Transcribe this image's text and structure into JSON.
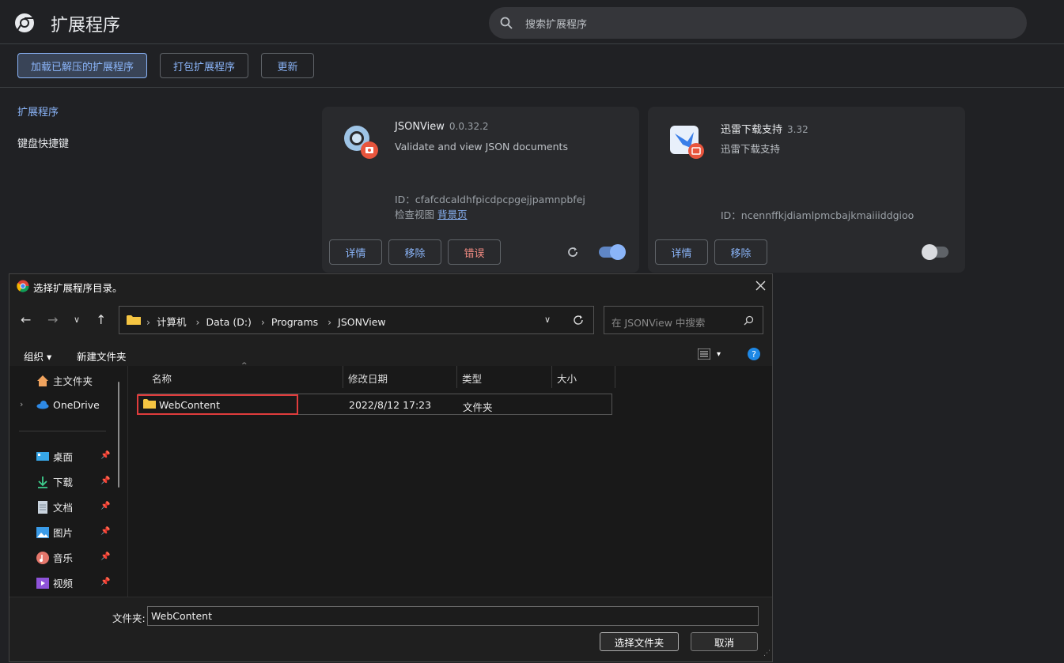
{
  "header": {
    "title": "扩展程序",
    "search_placeholder": "搜索扩展程序"
  },
  "toolbar": {
    "load_unpacked": "加载已解压的扩展程序",
    "pack": "打包扩展程序",
    "update": "更新"
  },
  "sidebar": {
    "items": [
      {
        "label": "扩展程序"
      },
      {
        "label": "键盘快捷键"
      }
    ]
  },
  "extensions": [
    {
      "name": "JSONView",
      "version": "0.0.32.2",
      "description": "Validate and view JSON documents",
      "id_line": "ID：cfafcdcaldhfpicdpcpgejjpamnpbfej",
      "inspect_label": "检查视图",
      "inspect_link": "背景页",
      "buttons": {
        "details": "详情",
        "remove": "移除",
        "errors": "错误"
      },
      "enabled": true
    },
    {
      "name": "迅雷下载支持",
      "version": "3.32",
      "description": "迅雷下载支持",
      "id_line": "ID：ncennffkjdiamlpmcbajkmaiiiddgioo",
      "buttons": {
        "details": "详情",
        "remove": "移除"
      },
      "enabled": false
    }
  ],
  "dialog": {
    "title": "选择扩展程序目录。",
    "breadcrumbs": [
      "计算机",
      "Data (D:)",
      "Programs",
      "JSONView"
    ],
    "search_placeholder": "在 JSONView 中搜索",
    "commands": {
      "organize": "组织",
      "new_folder": "新建文件夹"
    },
    "nav_items": [
      {
        "label": "主文件夹",
        "icon": "home-icon"
      },
      {
        "label": "OneDrive",
        "icon": "onedrive-icon"
      },
      {
        "label": "桌面",
        "icon": "desktop-icon"
      },
      {
        "label": "下载",
        "icon": "download-icon"
      },
      {
        "label": "文档",
        "icon": "document-icon"
      },
      {
        "label": "图片",
        "icon": "picture-icon"
      },
      {
        "label": "音乐",
        "icon": "music-icon"
      },
      {
        "label": "视频",
        "icon": "video-icon"
      }
    ],
    "columns": {
      "name": "名称",
      "modified": "修改日期",
      "type": "类型",
      "size": "大小"
    },
    "files": [
      {
        "name": "WebContent",
        "modified": "2022/8/12 17:23",
        "type": "文件夹",
        "size": ""
      }
    ],
    "folder_label": "文件夹:",
    "folder_value": "WebContent",
    "select_button": "选择文件夹",
    "cancel_button": "取消"
  }
}
